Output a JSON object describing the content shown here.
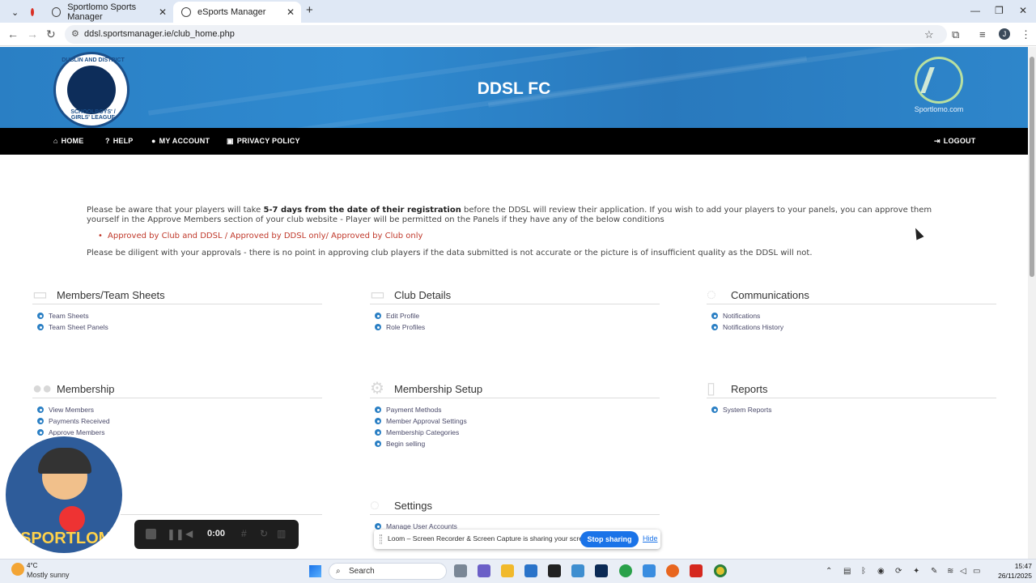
{
  "browser": {
    "tabs": [
      {
        "label": "Sportlomo Sports Manager"
      },
      {
        "label": "eSports Manager"
      }
    ],
    "url": "ddsl.sportsmanager.ie/club_home.php"
  },
  "header": {
    "crest_top": "DUBLIN AND DISTRICT",
    "crest_bottom": "SCHOOLBOYS' / GIRLS' LEAGUE",
    "title": "DDSL FC",
    "partner_name": "Sportlomo.com"
  },
  "nav": {
    "home": "HOME",
    "help": "HELP",
    "account": "MY ACCOUNT",
    "privacy": "PRIVACY POLICY",
    "logout": "LOGOUT"
  },
  "notice": {
    "p1_a": "Please be aware that your players will take ",
    "p1_bold": "5-7 days from the date of their registration",
    "p1_b": " before the DDSL will review their application. If you wish to add your players to your panels, you can approve them yourself in the Approve Members section of your club website - Player will be permitted on the Panels if they have any of the below conditions",
    "condition": "Approved by Club and DDSL / Approved by DDSL only/ Approved by Club only",
    "p2": "Please be diligent with your approvals - there is no point in approving club players if the data submitted is not accurate or the picture is of insufficient quality as the DDSL will not."
  },
  "sections": {
    "members": {
      "title": "Members/Team Sheets",
      "items": [
        "Team Sheets",
        "Team Sheet Panels"
      ]
    },
    "club": {
      "title": "Club Details",
      "items": [
        "Edit Profile",
        "Role Profiles"
      ]
    },
    "comms": {
      "title": "Communications",
      "items": [
        "Notifications",
        "Notifications History"
      ]
    },
    "membership": {
      "title": "Membership",
      "items": [
        "View Members",
        "Payments Received",
        "Approve Members"
      ]
    },
    "setup": {
      "title": "Membership Setup",
      "items": [
        "Payment Methods",
        "Member Approval Settings",
        "Membership Categories",
        "Begin selling"
      ]
    },
    "reports": {
      "title": "Reports",
      "items": [
        "System Reports"
      ]
    },
    "settings": {
      "title": "Settings",
      "items": [
        "Manage User Accounts"
      ]
    }
  },
  "loom": {
    "mascot_word": "SPORTLOMO",
    "time": "0:00",
    "share_msg": "Loom – Screen Recorder & Screen Capture is sharing your screen.",
    "stop": "Stop sharing",
    "hide": "Hide"
  },
  "taskbar": {
    "temp": "4°C",
    "weather": "Mostly sunny",
    "search": "Search",
    "time": "15:47",
    "date": "26/11/2025"
  }
}
